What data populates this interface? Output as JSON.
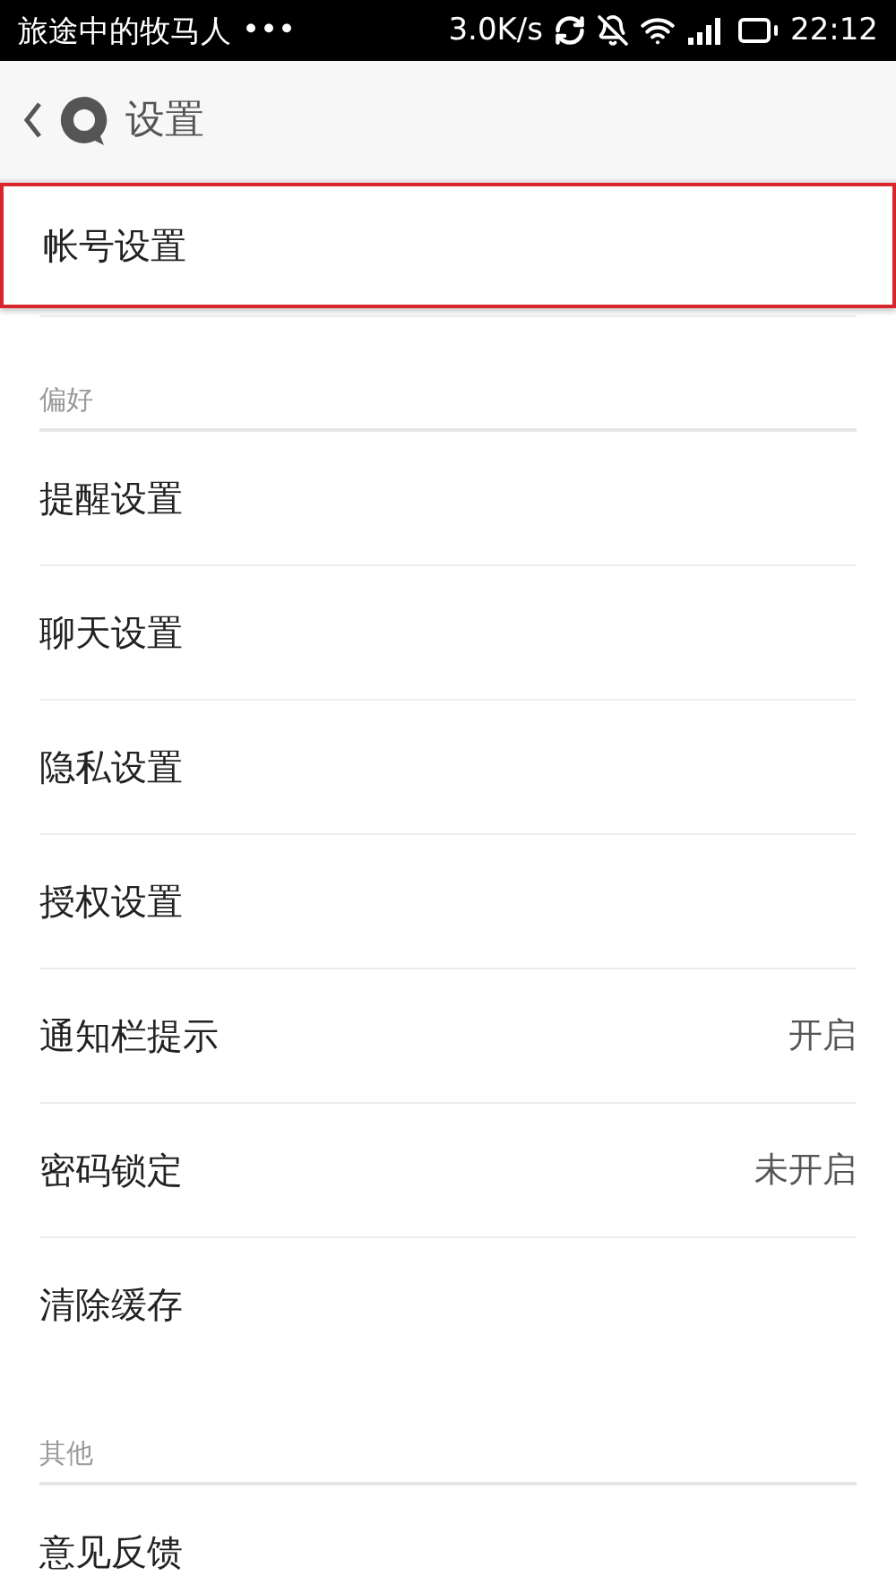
{
  "status_bar": {
    "notification": "旅途中的牧马人",
    "dots": "•••",
    "speed": "3.0K/s",
    "time": "22:12"
  },
  "header": {
    "title": "设置"
  },
  "sections": [
    {
      "items": [
        {
          "label": "帐号设置",
          "highlighted": true
        }
      ]
    },
    {
      "header": "偏好",
      "items": [
        {
          "label": "提醒设置",
          "highlighted": false
        },
        {
          "label": "聊天设置",
          "highlighted": false
        },
        {
          "label": "隐私设置",
          "highlighted": false
        },
        {
          "label": "授权设置",
          "highlighted": false
        },
        {
          "label": "通知栏提示",
          "value": "开启",
          "highlighted": false
        },
        {
          "label": "密码锁定",
          "value": "未开启",
          "highlighted": false
        },
        {
          "label": "清除缓存",
          "highlighted": false
        }
      ]
    },
    {
      "header": "其他",
      "items": [
        {
          "label": "意见反馈",
          "highlighted": false
        }
      ]
    }
  ]
}
